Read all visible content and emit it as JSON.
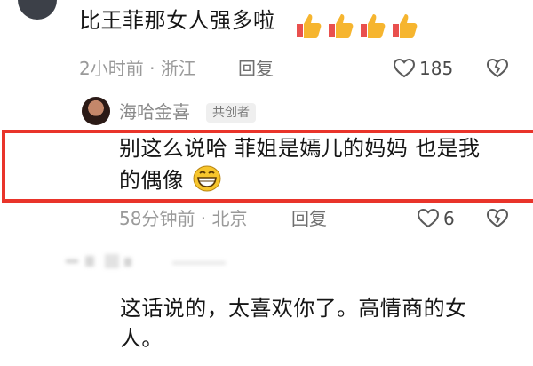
{
  "comment1": {
    "text": "比王菲那女人强多啦",
    "emoji": [
      "thumbs-up",
      "thumbs-up",
      "thumbs-up",
      "thumbs-up"
    ],
    "time": "2小时前",
    "location": "浙江",
    "reply": "回复",
    "likes": "185"
  },
  "comment2": {
    "username": "海哈金喜",
    "badge": "共创者",
    "text_line1": "别这么说哈 菲姐是嫣儿的妈妈 也是我",
    "text_line2": "的偶像",
    "emoji": "grinning-face",
    "time": "58分钟前",
    "location": "北京",
    "reply": "回复",
    "likes": "6"
  },
  "comment3": {
    "text_line1": "这话说的，太喜欢你了。高情商的女",
    "text_line2": "人。"
  },
  "colors": {
    "highlight_border": "#e9342a",
    "meta_text": "#9a9a9a"
  }
}
